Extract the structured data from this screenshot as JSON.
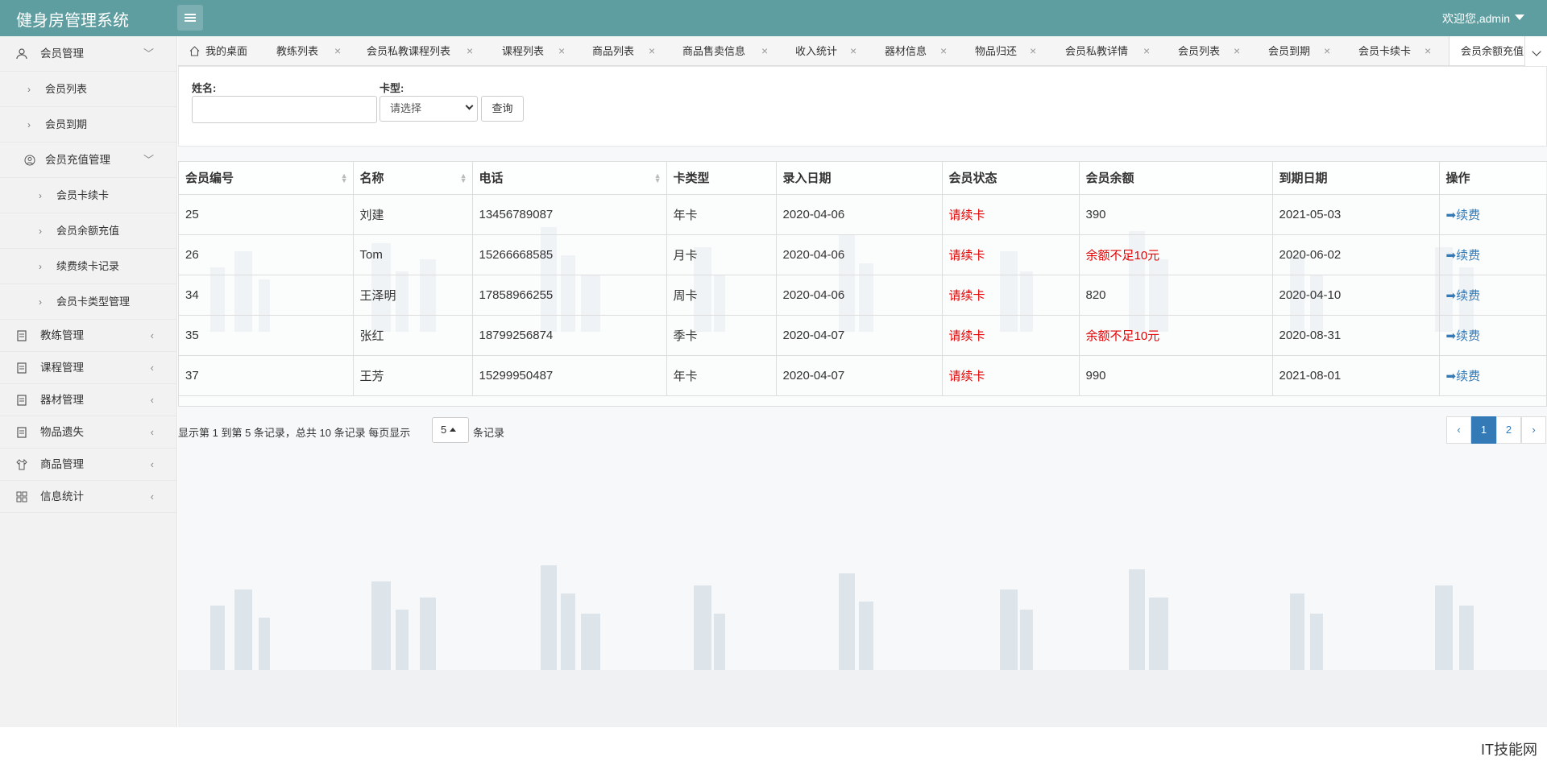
{
  "header": {
    "title": "健身房管理系统",
    "user": "欢迎您,admin"
  },
  "sidebar": {
    "member_mgmt": "会员管理",
    "member_list": "会员列表",
    "member_expire": "会员到期",
    "recharge_mgmt": "会员充值管理",
    "card_renew": "会员卡续卡",
    "balance_recharge": "会员余额充值",
    "renew_records": "续费续卡记录",
    "card_type_mgmt": "会员卡类型管理",
    "coach_mgmt": "教练管理",
    "course_mgmt": "课程管理",
    "equipment_mgmt": "器材管理",
    "lost_items": "物品遗失",
    "goods_mgmt": "商品管理",
    "stats": "信息统计"
  },
  "tabs": {
    "home": "我的桌面",
    "t1": "教练列表",
    "t2": "会员私教课程列表",
    "t3": "课程列表",
    "t4": "商品列表",
    "t5": "商品售卖信息",
    "t6": "收入统计",
    "t7": "器材信息",
    "t8": "物品归还",
    "t9": "会员私教详情",
    "t10": "会员列表",
    "t11": "会员到期",
    "t12": "会员卡续卡",
    "t13": "会员余额充值"
  },
  "search": {
    "name_label": "姓名:",
    "name_value": "",
    "card_label": "卡型:",
    "card_placeholder": "请选择",
    "query_button": "查询"
  },
  "table": {
    "headers": [
      "会员编号",
      "名称",
      "电话",
      "卡类型",
      "录入日期",
      "会员状态",
      "会员余额",
      "到期日期",
      "操作"
    ],
    "rows": [
      {
        "id": "25",
        "name": "刘建",
        "phone": "13456789087",
        "card": "年卡",
        "date": "2020-04-06",
        "status": "请续卡",
        "balance": "390",
        "expire": "2021-05-03",
        "op": "➡续费"
      },
      {
        "id": "26",
        "name": "Tom",
        "phone": "15266668585",
        "card": "月卡",
        "date": "2020-04-06",
        "status": "请续卡",
        "balance": "余额不足10元",
        "expire": "2020-06-02",
        "op": "➡续费"
      },
      {
        "id": "34",
        "name": "王泽明",
        "phone": "17858966255",
        "card": "周卡",
        "date": "2020-04-06",
        "status": "请续卡",
        "balance": "820",
        "expire": "2020-04-10",
        "op": "➡续费"
      },
      {
        "id": "35",
        "name": "张红",
        "phone": "18799256874",
        "card": "季卡",
        "date": "2020-04-07",
        "status": "请续卡",
        "balance": "余额不足10元",
        "expire": "2020-08-31",
        "op": "➡续费"
      },
      {
        "id": "37",
        "name": "王芳",
        "phone": "15299950487",
        "card": "年卡",
        "date": "2020-04-07",
        "status": "请续卡",
        "balance": "990",
        "expire": "2021-08-01",
        "op": "➡续费"
      }
    ]
  },
  "pager": {
    "info": "显示第 1 到第 5 条记录，总共 10 条记录 每页显示",
    "page_size": "5",
    "tail": "条记录",
    "prev": "‹",
    "p1": "1",
    "p2": "2",
    "next": "›"
  },
  "footer": {
    "mark": "IT技能网"
  },
  "colors": {
    "header": "#5f9ea0",
    "alert": "#e60000",
    "link": "#337ab7"
  }
}
